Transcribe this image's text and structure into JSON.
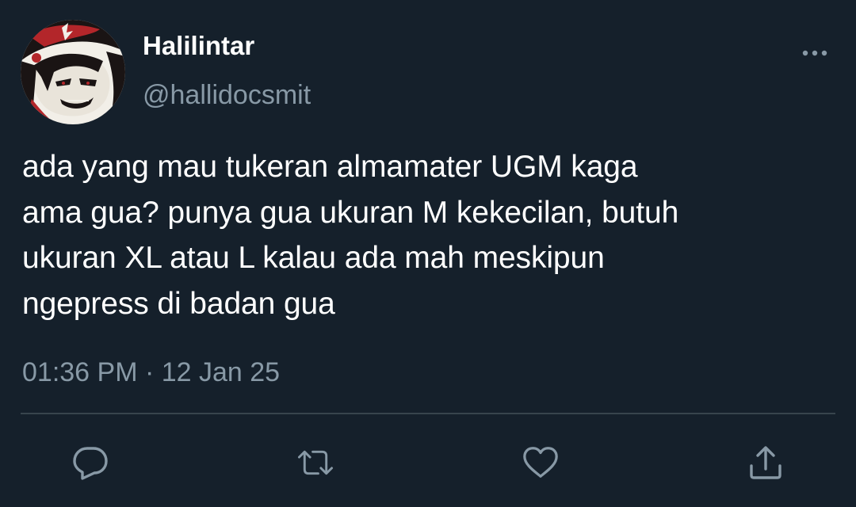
{
  "user": {
    "display_name": "Halilintar",
    "handle": "@hallidocsmit"
  },
  "tweet": {
    "text": "ada yang mau tukeran almamater UGM kaga\nama gua? punya gua ukuran M kekecilan, butuh\nukuran XL atau L kalau ada mah meskipun\nngepress di badan gua",
    "timestamp": "01:36 PM · 12 Jan 25"
  },
  "actions": [
    {
      "name": "reply",
      "icon": "reply-icon"
    },
    {
      "name": "retweet",
      "icon": "retweet-icon"
    },
    {
      "name": "like",
      "icon": "heart-icon"
    },
    {
      "name": "share",
      "icon": "share-icon"
    }
  ],
  "colors": {
    "background": "#15202b",
    "primary_text": "#ffffff",
    "secondary_text": "#8899a6",
    "divider": "#38444d"
  }
}
